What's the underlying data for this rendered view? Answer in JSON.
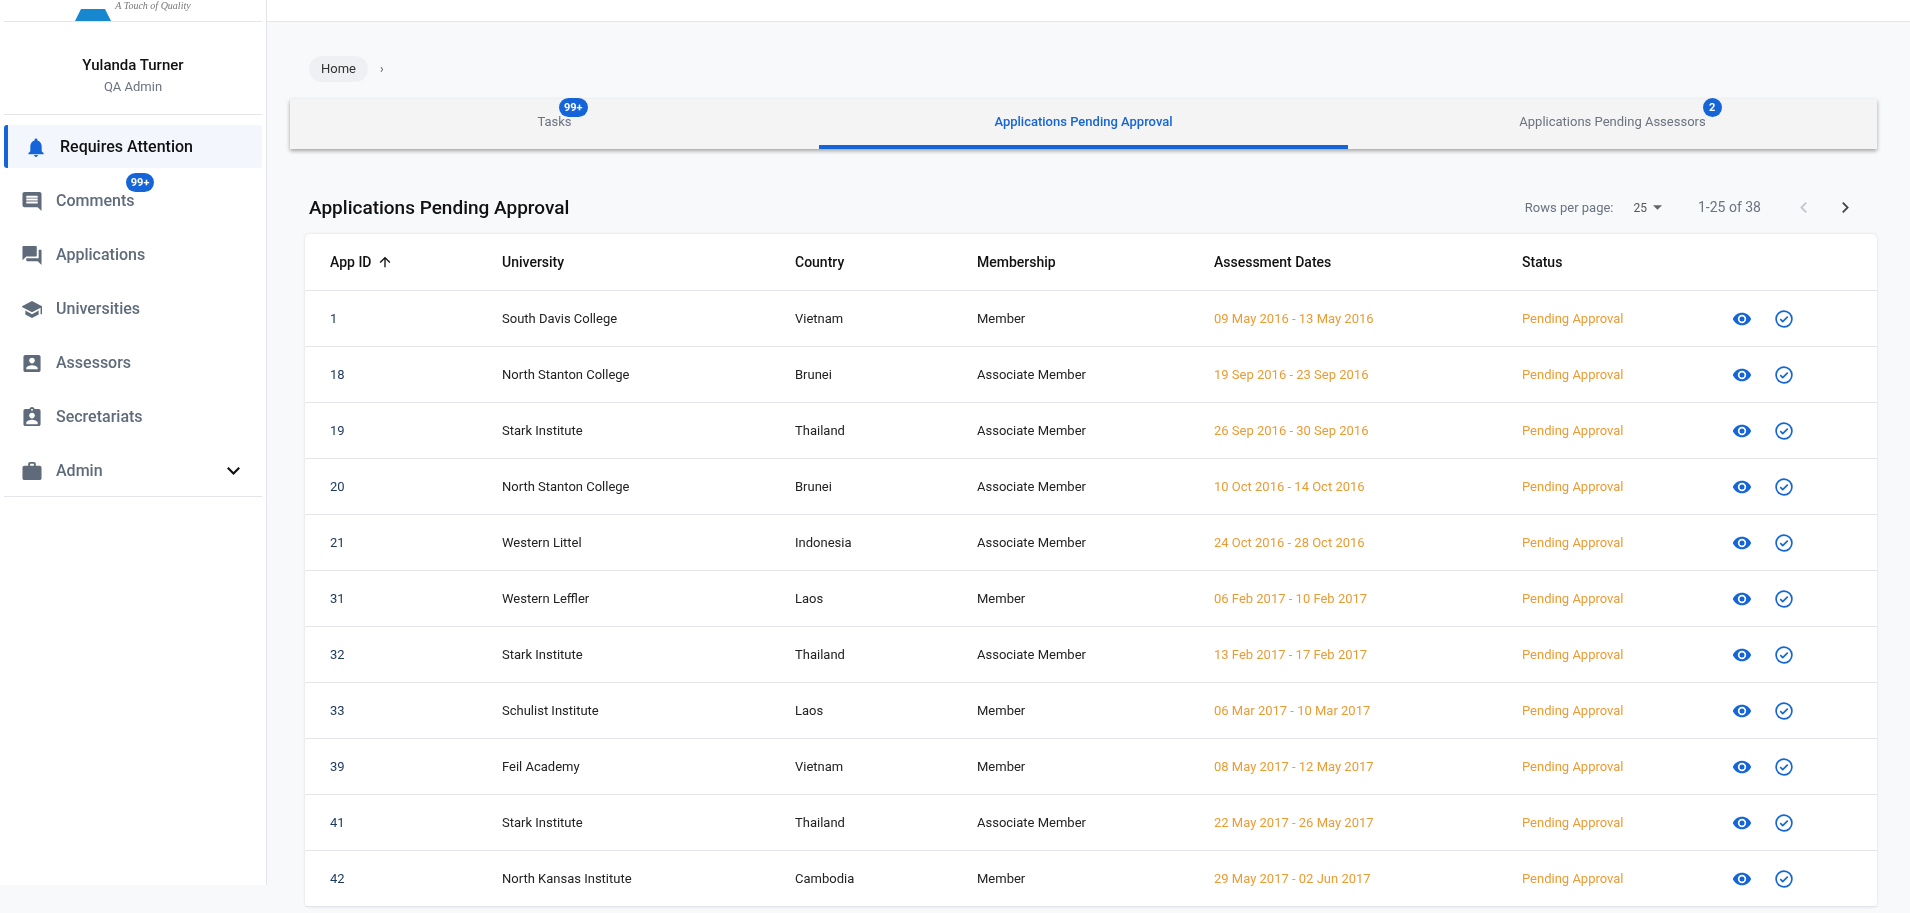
{
  "logo": {
    "tagline": "A Touch of Quality"
  },
  "user": {
    "name": "Yulanda Turner",
    "role": "QA Admin"
  },
  "sidebar": {
    "items": [
      {
        "label": "Requires Attention",
        "selected": true
      },
      {
        "label": "Comments",
        "selected": false,
        "badge": "99+"
      },
      {
        "label": "Applications",
        "selected": false
      },
      {
        "label": "Universities",
        "selected": false
      },
      {
        "label": "Assessors",
        "selected": false
      },
      {
        "label": "Secretariats",
        "selected": false
      },
      {
        "label": "Admin",
        "selected": false,
        "expandable": true
      }
    ]
  },
  "breadcrumb": {
    "items": [
      "Home"
    ],
    "separator": "›"
  },
  "tabs": [
    {
      "label": "Tasks",
      "selected": false,
      "badge": "99+"
    },
    {
      "label": "Applications Pending Approval",
      "selected": true
    },
    {
      "label": "Applications Pending Assessors",
      "selected": false,
      "badge": "2"
    }
  ],
  "table": {
    "title": "Applications Pending Approval",
    "pagination": {
      "rows_label": "Rows per page:",
      "rows_value": "25",
      "range": "1-25 of 38"
    },
    "columns": [
      "App ID",
      "University",
      "Country",
      "Membership",
      "Assessment Dates",
      "Status"
    ],
    "rows": [
      [
        "1",
        "South Davis College",
        "Vietnam",
        "Member",
        "09 May 2016 - 13 May 2016",
        "Pending Approval"
      ],
      [
        "18",
        "North Stanton College",
        "Brunei",
        "Associate Member",
        "19 Sep 2016 - 23 Sep 2016",
        "Pending Approval"
      ],
      [
        "19",
        "Stark Institute",
        "Thailand",
        "Associate Member",
        "26 Sep 2016 - 30 Sep 2016",
        "Pending Approval"
      ],
      [
        "20",
        "North Stanton College",
        "Brunei",
        "Associate Member",
        "10 Oct 2016 - 14 Oct 2016",
        "Pending Approval"
      ],
      [
        "21",
        "Western Littel",
        "Indonesia",
        "Associate Member",
        "24 Oct 2016 - 28 Oct 2016",
        "Pending Approval"
      ],
      [
        "31",
        "Western Leffler",
        "Laos",
        "Member",
        "06 Feb 2017 - 10 Feb 2017",
        "Pending Approval"
      ],
      [
        "32",
        "Stark Institute",
        "Thailand",
        "Associate Member",
        "13 Feb 2017 - 17 Feb 2017",
        "Pending Approval"
      ],
      [
        "33",
        "Schulist Institute",
        "Laos",
        "Member",
        "06 Mar 2017 - 10 Mar 2017",
        "Pending Approval"
      ],
      [
        "39",
        "Feil Academy",
        "Vietnam",
        "Member",
        "08 May 2017 - 12 May 2017",
        "Pending Approval"
      ],
      [
        "41",
        "Stark Institute",
        "Thailand",
        "Associate Member",
        "22 May 2017 - 26 May 2017",
        "Pending Approval"
      ],
      [
        "42",
        "North Kansas Institute",
        "Cambodia",
        "Member",
        "29 May 2017 - 02 Jun 2017",
        "Pending Approval"
      ]
    ]
  }
}
